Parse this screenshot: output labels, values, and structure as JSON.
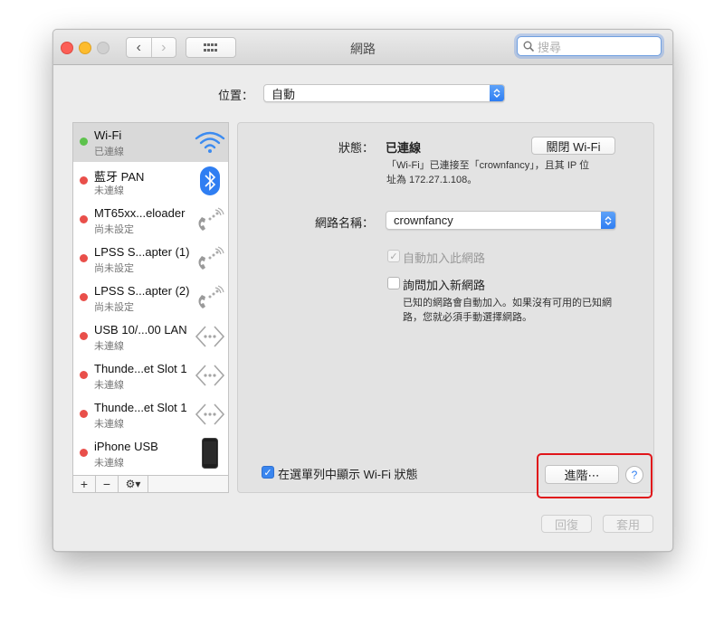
{
  "window": {
    "title": "網路"
  },
  "toolbar": {
    "back_label": "‹",
    "forward_label": "›"
  },
  "search": {
    "placeholder": "搜尋"
  },
  "location": {
    "label": "位置：",
    "value": "自動"
  },
  "sidebar": {
    "items": [
      {
        "name": "Wi-Fi",
        "status": "已連線",
        "status_color": "#5dc24c",
        "icon": "wifi-icon"
      },
      {
        "name": "藍牙 PAN",
        "status": "未連線",
        "status_color": "#e94f4a",
        "icon": "bluetooth-icon"
      },
      {
        "name": "MT65xx...eloader",
        "status": "尚未設定",
        "status_color": "#e94f4a",
        "icon": "phone-icon"
      },
      {
        "name": "LPSS S...apter (1)",
        "status": "尚未設定",
        "status_color": "#e94f4a",
        "icon": "phone-icon"
      },
      {
        "name": "LPSS S...apter (2)",
        "status": "尚未設定",
        "status_color": "#e94f4a",
        "icon": "phone-icon"
      },
      {
        "name": "USB 10/...00 LAN",
        "status": "未連線",
        "status_color": "#e94f4a",
        "icon": "ethernet-icon"
      },
      {
        "name": "Thunde...et Slot 1",
        "status": "未連線",
        "status_color": "#e94f4a",
        "icon": "ethernet-icon"
      },
      {
        "name": "Thunde...et Slot 1",
        "status": "未連線",
        "status_color": "#e94f4a",
        "icon": "ethernet-icon"
      },
      {
        "name": "iPhone USB",
        "status": "未連線",
        "status_color": "#e94f4a",
        "icon": "iphone-icon"
      }
    ],
    "tools": {
      "add": "+",
      "remove": "−",
      "gear": "⚙▾"
    }
  },
  "detail": {
    "status_label": "狀態：",
    "status_value": "已連線",
    "turn_off_button": "關閉 Wi-Fi",
    "status_desc_line1": "「Wi-Fi」已連接至「crownfancy」，且其 IP 位",
    "status_desc_line2": "址為 172.27.1.108。",
    "network_name_label": "網路名稱：",
    "network_name_value": "crownfancy",
    "auto_join_label": "自動加入此網路",
    "ask_join_label": "詢問加入新網路",
    "ask_join_desc_line1": "已知的網路會自動加入。如果沒有可用的已知網",
    "ask_join_desc_line2": "路，您就必須手動選擇網路。",
    "show_menubar_label": "在選單列中顯示 Wi-Fi 狀態",
    "advanced_button": "進階⋯",
    "help_label": "?"
  },
  "footer": {
    "revert_button": "回復",
    "apply_button": "套用"
  },
  "colors": {
    "accent": "#2f7ef2",
    "highlight": "#e0151a"
  }
}
